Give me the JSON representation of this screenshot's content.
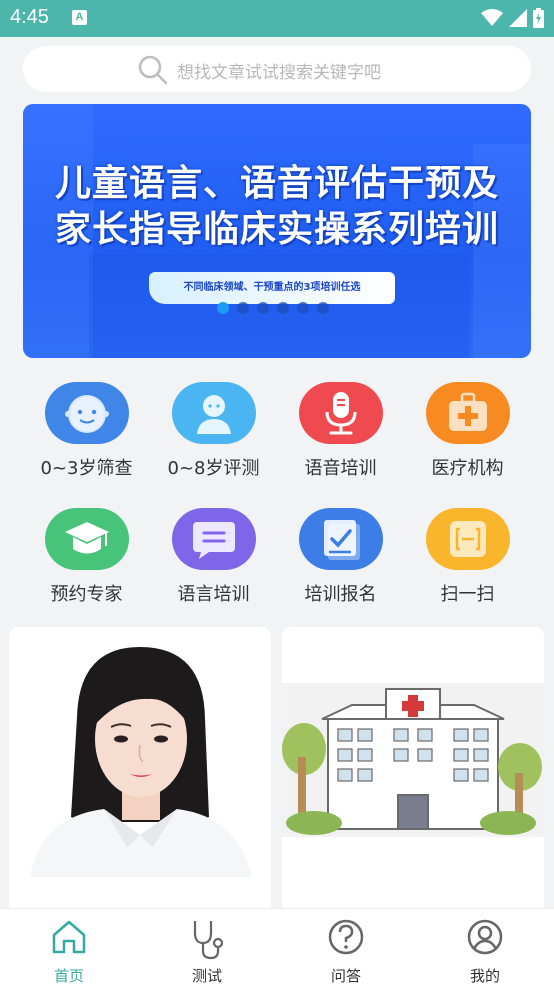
{
  "status": {
    "time": "4:45",
    "notification": "A"
  },
  "search": {
    "placeholder": "想找文章试试搜索关键字吧"
  },
  "banner": {
    "line1": "儿童语言、语音评估干预及",
    "line2": "家长指导临床实操系列培训",
    "pill": "不同临床领域、干预重点的3项培训任选",
    "dots_total": 6,
    "dots_active": 0
  },
  "menu": [
    {
      "label": "0~3岁筛查",
      "icon": "baby-face-icon",
      "color": "#3f86e8"
    },
    {
      "label": "0~8岁评测",
      "icon": "child-person-icon",
      "color": "#4ab5f0"
    },
    {
      "label": "语音培训",
      "icon": "microphone-icon",
      "color": "#ef4a4f"
    },
    {
      "label": "医疗机构",
      "icon": "medical-kit-icon",
      "color": "#f88a22"
    },
    {
      "label": "预约专家",
      "icon": "graduation-cap-icon",
      "color": "#47c47a"
    },
    {
      "label": "语言培训",
      "icon": "chat-bubble-icon",
      "color": "#7e66e8"
    },
    {
      "label": "培训报名",
      "icon": "book-check-icon",
      "color": "#3c7ee6"
    },
    {
      "label": "扫一扫",
      "icon": "scan-icon",
      "color": "#f9b52b"
    }
  ],
  "tabs": [
    {
      "label": "首页",
      "icon": "home-icon",
      "active": true
    },
    {
      "label": "测试",
      "icon": "stethoscope-icon",
      "active": false
    },
    {
      "label": "问答",
      "icon": "question-icon",
      "active": false
    },
    {
      "label": "我的",
      "icon": "profile-icon",
      "active": false
    }
  ]
}
